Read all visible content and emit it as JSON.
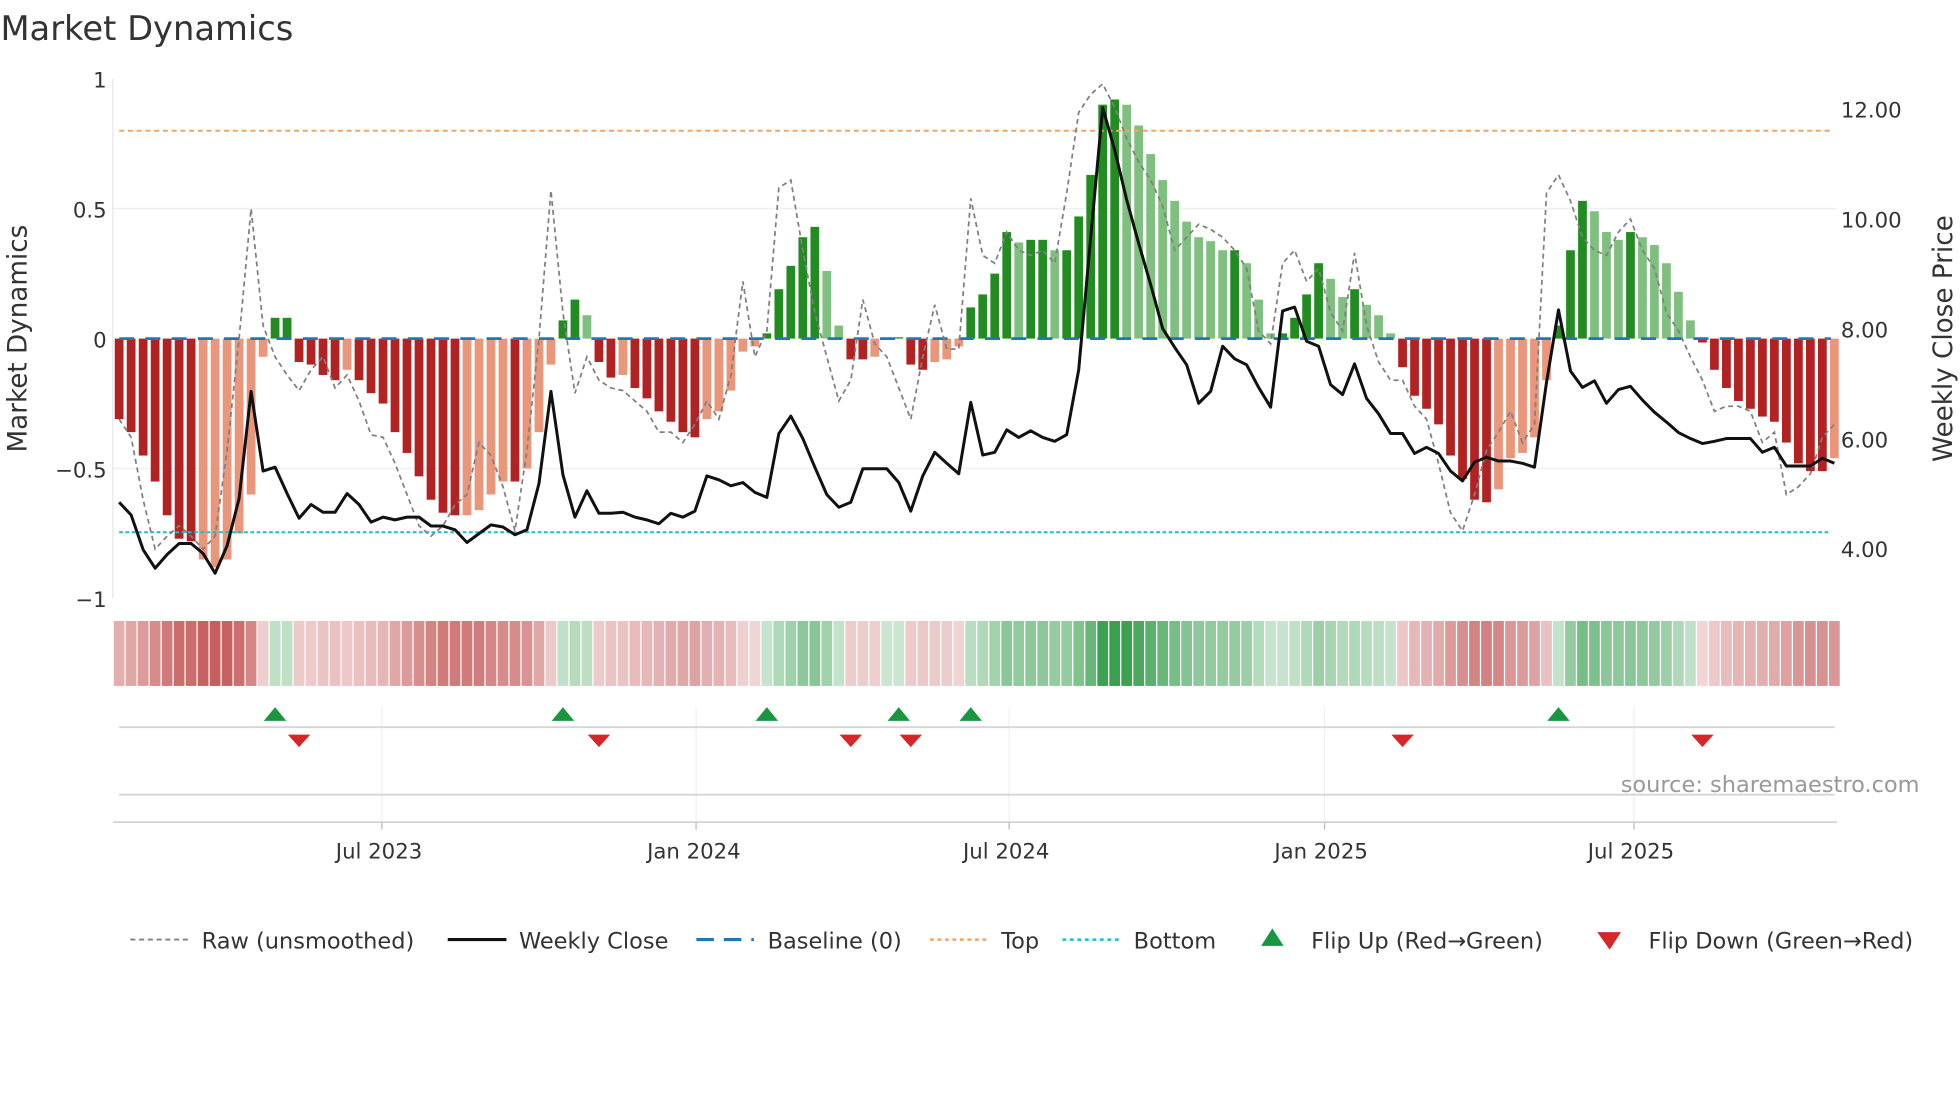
{
  "title": "Market Dynamics",
  "source": "source: sharemaestro.com",
  "colors": {
    "strong_red": "#b22222",
    "weak_red": "#e9967a",
    "strong_green": "#228b22",
    "weak_green": "#7fbf7f",
    "raw": "#808080",
    "close": "#111111",
    "baseline": "#1f77b4",
    "top": "#f4a460",
    "bottom": "#17becf",
    "flip_up": "#1a9641",
    "flip_down": "#d62728"
  },
  "chart_data": {
    "type": "bar",
    "title": "Market Dynamics",
    "ylabel": "Market Dynamics",
    "y2label": "Weekly Close Price",
    "ylim": [
      -1,
      1
    ],
    "y2lim": [
      3.64,
      13.11
    ],
    "yticks": [
      "1",
      "0.5",
      "0",
      "−0.5",
      "−1"
    ],
    "ytick_values": [
      1,
      0.5,
      0,
      -0.5,
      -1
    ],
    "y2ticks": [
      "12.00",
      "10.00",
      "8.00",
      "6.00",
      "4.00"
    ],
    "y2tick_values": [
      12,
      10,
      8,
      6,
      4
    ],
    "xticks": [
      "Jul 2023",
      "Jan 2024",
      "Jul 2024",
      "Jan 2025",
      "Jul 2025"
    ],
    "xtick_week_index": [
      22.9,
      49.1,
      75.2,
      101.5,
      127.3
    ],
    "top_level": 0.8,
    "bottom_level": -0.745,
    "baseline": 0,
    "bars": [
      -0.31,
      -0.36,
      -0.45,
      -0.55,
      -0.68,
      -0.77,
      -0.78,
      -0.85,
      -0.88,
      -0.85,
      -0.75,
      -0.6,
      -0.07,
      0.08,
      0.08,
      -0.09,
      -0.1,
      -0.14,
      -0.16,
      -0.12,
      -0.16,
      -0.21,
      -0.25,
      -0.36,
      -0.44,
      -0.53,
      -0.62,
      -0.67,
      -0.68,
      -0.68,
      -0.66,
      -0.6,
      -0.55,
      -0.55,
      -0.5,
      -0.36,
      -0.1,
      0.07,
      0.15,
      0.09,
      -0.09,
      -0.15,
      -0.14,
      -0.19,
      -0.23,
      -0.28,
      -0.32,
      -0.36,
      -0.38,
      -0.31,
      -0.28,
      -0.2,
      -0.05,
      -0.03,
      0.02,
      0.19,
      0.28,
      0.39,
      0.43,
      0.26,
      0.05,
      -0.08,
      -0.08,
      -0.07,
      0.0,
      0.005,
      -0.1,
      -0.12,
      -0.09,
      -0.08,
      -0.03,
      0.12,
      0.17,
      0.25,
      0.41,
      0.37,
      0.38,
      0.38,
      0.34,
      0.34,
      0.47,
      0.63,
      0.9,
      0.92,
      0.9,
      0.82,
      0.71,
      0.61,
      0.53,
      0.45,
      0.39,
      0.375,
      0.34,
      0.34,
      0.29,
      0.15,
      0.02,
      0.02,
      0.08,
      0.17,
      0.29,
      0.23,
      0.16,
      0.19,
      0.13,
      0.09,
      0.02,
      -0.11,
      -0.22,
      -0.27,
      -0.33,
      -0.45,
      -0.54,
      -0.62,
      -0.63,
      -0.58,
      -0.46,
      -0.44,
      -0.38,
      -0.16,
      0.05,
      0.34,
      0.53,
      0.49,
      0.41,
      0.38,
      0.41,
      0.39,
      0.36,
      0.29,
      0.18,
      0.07,
      -0.015,
      -0.12,
      -0.19,
      -0.24,
      -0.27,
      -0.3,
      -0.32,
      -0.4,
      -0.48,
      -0.51,
      -0.51,
      -0.46
    ],
    "bar_strength": "SSSSSSSWWWWWWSSSSSSWSSSSSSSSSWWWWSWWWSSWSSWSSSSSSWWWWWSSSSSWWSSWWSSSWWWSSSSWSSWSSSSSWWWWWWWWWSWWWSSSSWWSWWWSSSSSSSSWWWWWSSSWWWSWWWWWSSSSSSSSSSSW",
    "raw": [
      -0.31,
      -0.38,
      -0.62,
      -0.81,
      -0.76,
      -0.72,
      -0.76,
      -0.81,
      -0.76,
      -0.43,
      0.0,
      0.5,
      0.05,
      -0.07,
      -0.14,
      -0.2,
      -0.12,
      -0.07,
      -0.19,
      -0.14,
      -0.24,
      -0.37,
      -0.38,
      -0.48,
      -0.6,
      -0.72,
      -0.76,
      -0.72,
      -0.64,
      -0.6,
      -0.4,
      -0.45,
      -0.57,
      -0.74,
      -0.43,
      0.0,
      0.57,
      0.1,
      -0.21,
      -0.07,
      -0.16,
      -0.19,
      -0.2,
      -0.24,
      -0.28,
      -0.36,
      -0.36,
      -0.4,
      -0.33,
      -0.24,
      -0.31,
      -0.14,
      0.22,
      -0.07,
      0.03,
      0.58,
      0.61,
      0.34,
      0.1,
      -0.07,
      -0.24,
      -0.16,
      0.15,
      -0.02,
      -0.07,
      -0.19,
      -0.31,
      -0.07,
      0.13,
      -0.04,
      -0.04,
      0.54,
      0.32,
      0.29,
      0.41,
      0.34,
      0.32,
      0.34,
      0.29,
      0.56,
      0.87,
      0.94,
      0.98,
      0.89,
      0.77,
      0.68,
      0.61,
      0.51,
      0.34,
      0.39,
      0.44,
      0.42,
      0.39,
      0.34,
      0.27,
      0.03,
      -0.02,
      0.29,
      0.34,
      0.22,
      0.27,
      0.1,
      0.03,
      0.33,
      0.05,
      -0.09,
      -0.16,
      -0.16,
      -0.26,
      -0.31,
      -0.48,
      -0.67,
      -0.74,
      -0.6,
      -0.43,
      -0.36,
      -0.28,
      -0.4,
      -0.33,
      0.56,
      0.63,
      0.53,
      0.39,
      0.34,
      0.32,
      0.41,
      0.46,
      0.34,
      0.27,
      0.1,
      0.03,
      -0.07,
      -0.16,
      -0.28,
      -0.26,
      -0.26,
      -0.28,
      -0.4,
      -0.36,
      -0.6,
      -0.57,
      -0.52,
      -0.38,
      -0.33
    ],
    "close": [
      4.84,
      4.61,
      3.98,
      3.64,
      3.89,
      4.09,
      4.09,
      3.91,
      3.55,
      4.05,
      4.91,
      6.86,
      5.41,
      5.48,
      5.0,
      4.55,
      4.8,
      4.66,
      4.66,
      5.0,
      4.8,
      4.48,
      4.57,
      4.52,
      4.57,
      4.57,
      4.41,
      4.41,
      4.34,
      4.11,
      4.27,
      4.43,
      4.39,
      4.25,
      4.34,
      5.18,
      6.86,
      5.34,
      4.57,
      5.05,
      4.64,
      4.64,
      4.66,
      4.57,
      4.52,
      4.45,
      4.64,
      4.57,
      4.68,
      5.32,
      5.25,
      5.14,
      5.2,
      5.02,
      4.93,
      6.09,
      6.41,
      6.0,
      5.48,
      4.98,
      4.75,
      4.84,
      5.45,
      5.45,
      5.45,
      5.2,
      4.68,
      5.32,
      5.75,
      5.55,
      5.36,
      6.66,
      5.7,
      5.75,
      6.16,
      6.02,
      6.14,
      6.02,
      5.95,
      6.07,
      7.25,
      9.66,
      12.02,
      11.25,
      10.34,
      9.55,
      8.8,
      8.0,
      7.66,
      7.34,
      6.64,
      6.86,
      7.68,
      7.45,
      7.34,
      6.93,
      6.57,
      8.32,
      8.39,
      7.77,
      7.68,
      6.98,
      6.8,
      7.36,
      6.73,
      6.45,
      6.09,
      6.09,
      5.73,
      5.84,
      5.73,
      5.41,
      5.23,
      5.57,
      5.66,
      5.59,
      5.59,
      5.55,
      5.48,
      7.02,
      8.34,
      7.23,
      6.93,
      7.05,
      6.64,
      6.89,
      6.95,
      6.7,
      6.48,
      6.3,
      6.11,
      6.0,
      5.91,
      5.95,
      6.0,
      6.0,
      6.0,
      5.75,
      5.84,
      5.5,
      5.5,
      5.5,
      5.64,
      5.55
    ],
    "flip_up_week_index": [
      14,
      38,
      55,
      66,
      72,
      121
    ],
    "flip_down_week_index": [
      16,
      41,
      62,
      67,
      108,
      133
    ],
    "legend": {
      "placement": "bottom",
      "raw": "Raw (unsmoothed)",
      "close": "Weekly Close",
      "baseline": "Baseline (0)",
      "top": "Top",
      "bottom": "Bottom",
      "flip_up": "Flip Up (Red→Green)",
      "flip_down": "Flip Down (Green→Red)"
    }
  }
}
